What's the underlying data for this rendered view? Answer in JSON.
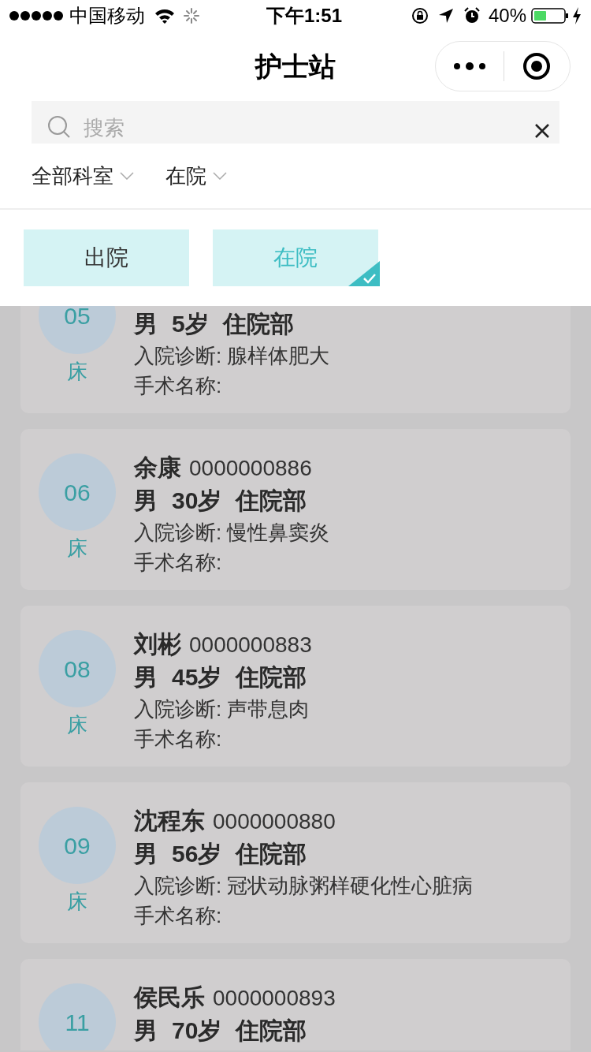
{
  "status_bar": {
    "carrier": "中国移动",
    "time": "下午1:51",
    "battery": "40%"
  },
  "nav": {
    "title": "护士站"
  },
  "search": {
    "placeholder": "搜索"
  },
  "filters": [
    {
      "label": "全部科室"
    },
    {
      "label": "在院"
    }
  ],
  "options": [
    {
      "label": "出院",
      "selected": false
    },
    {
      "label": "在院",
      "selected": true
    }
  ],
  "patients": [
    {
      "bed": "05",
      "bed_label": "床",
      "sex": "男",
      "age": "5岁",
      "ward": "住院部",
      "diagnosis": "入院诊断: 腺样体肥大",
      "surgery": "手术名称:"
    },
    {
      "bed": "06",
      "bed_label": "床",
      "name": "余康",
      "id": "0000000886",
      "sex": "男",
      "age": "30岁",
      "ward": "住院部",
      "diagnosis": "入院诊断: 慢性鼻窦炎",
      "surgery": "手术名称:"
    },
    {
      "bed": "08",
      "bed_label": "床",
      "name": "刘彬",
      "id": "0000000883",
      "sex": "男",
      "age": "45岁",
      "ward": "住院部",
      "diagnosis": "入院诊断: 声带息肉",
      "surgery": "手术名称:"
    },
    {
      "bed": "09",
      "bed_label": "床",
      "name": "沈程东",
      "id": "0000000880",
      "sex": "男",
      "age": "56岁",
      "ward": "住院部",
      "diagnosis": "入院诊断: 冠状动脉粥样硬化性心脏病",
      "surgery": "手术名称:"
    },
    {
      "bed": "11",
      "name": "侯民乐",
      "id": "0000000893",
      "sex": "男",
      "age": "70岁",
      "ward": "住院部"
    }
  ]
}
